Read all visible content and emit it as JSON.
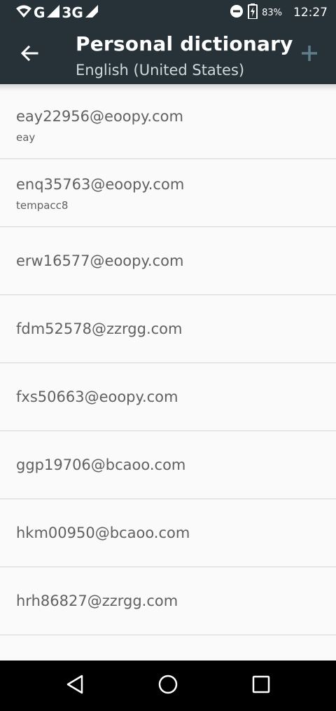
{
  "status_bar": {
    "network1": "G",
    "network2": "3G",
    "battery": "83%",
    "time": "12:27"
  },
  "app_bar": {
    "title": "Personal dictionary",
    "subtitle": "English (United States)",
    "accent": "#607d8b"
  },
  "entries": [
    {
      "word": "eay22956@eoopy.com",
      "shortcut": "eay"
    },
    {
      "word": "enq35763@eoopy.com",
      "shortcut": "tempacc8"
    },
    {
      "word": "erw16577@eoopy.com",
      "shortcut": ""
    },
    {
      "word": "fdm52578@zzrgg.com",
      "shortcut": ""
    },
    {
      "word": "fxs50663@eoopy.com",
      "shortcut": ""
    },
    {
      "word": "ggp19706@bcaoo.com",
      "shortcut": ""
    },
    {
      "word": "hkm00950@bcaoo.com",
      "shortcut": ""
    },
    {
      "word": "hrh86827@zzrgg.com",
      "shortcut": ""
    }
  ]
}
